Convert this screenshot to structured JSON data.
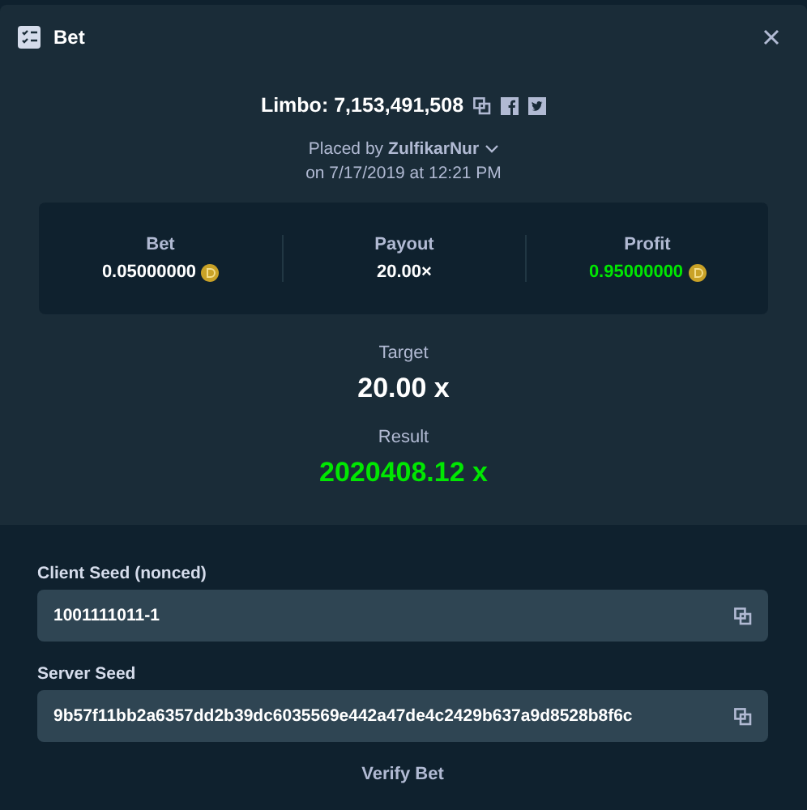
{
  "window": {
    "title": "Bet"
  },
  "bet": {
    "title": "Limbo: 7,153,491,508",
    "placed_by": "Placed by",
    "user": "ZulfikarNur",
    "date": "on 7/17/2019 at 12:21 PM"
  },
  "stats": [
    {
      "label": "Bet",
      "value": "0.05000000",
      "coin": true,
      "positive": false
    },
    {
      "label": "Payout",
      "value": "20.00×",
      "coin": false,
      "positive": false
    },
    {
      "label": "Profit",
      "value": "0.95000000",
      "coin": true,
      "positive": true
    }
  ],
  "target": {
    "label": "Target",
    "value": "20.00 x"
  },
  "result": {
    "label": "Result",
    "value": "2020408.12 x"
  },
  "seeds": [
    {
      "label": "Client Seed (nonced)",
      "value": "1001111011-1"
    },
    {
      "label": "Server Seed",
      "value": "9b57f11bb2a6357dd2b39dc6035569e442a47de4c2429b637a9d8528b8f6c"
    }
  ],
  "verify": "Verify Bet"
}
